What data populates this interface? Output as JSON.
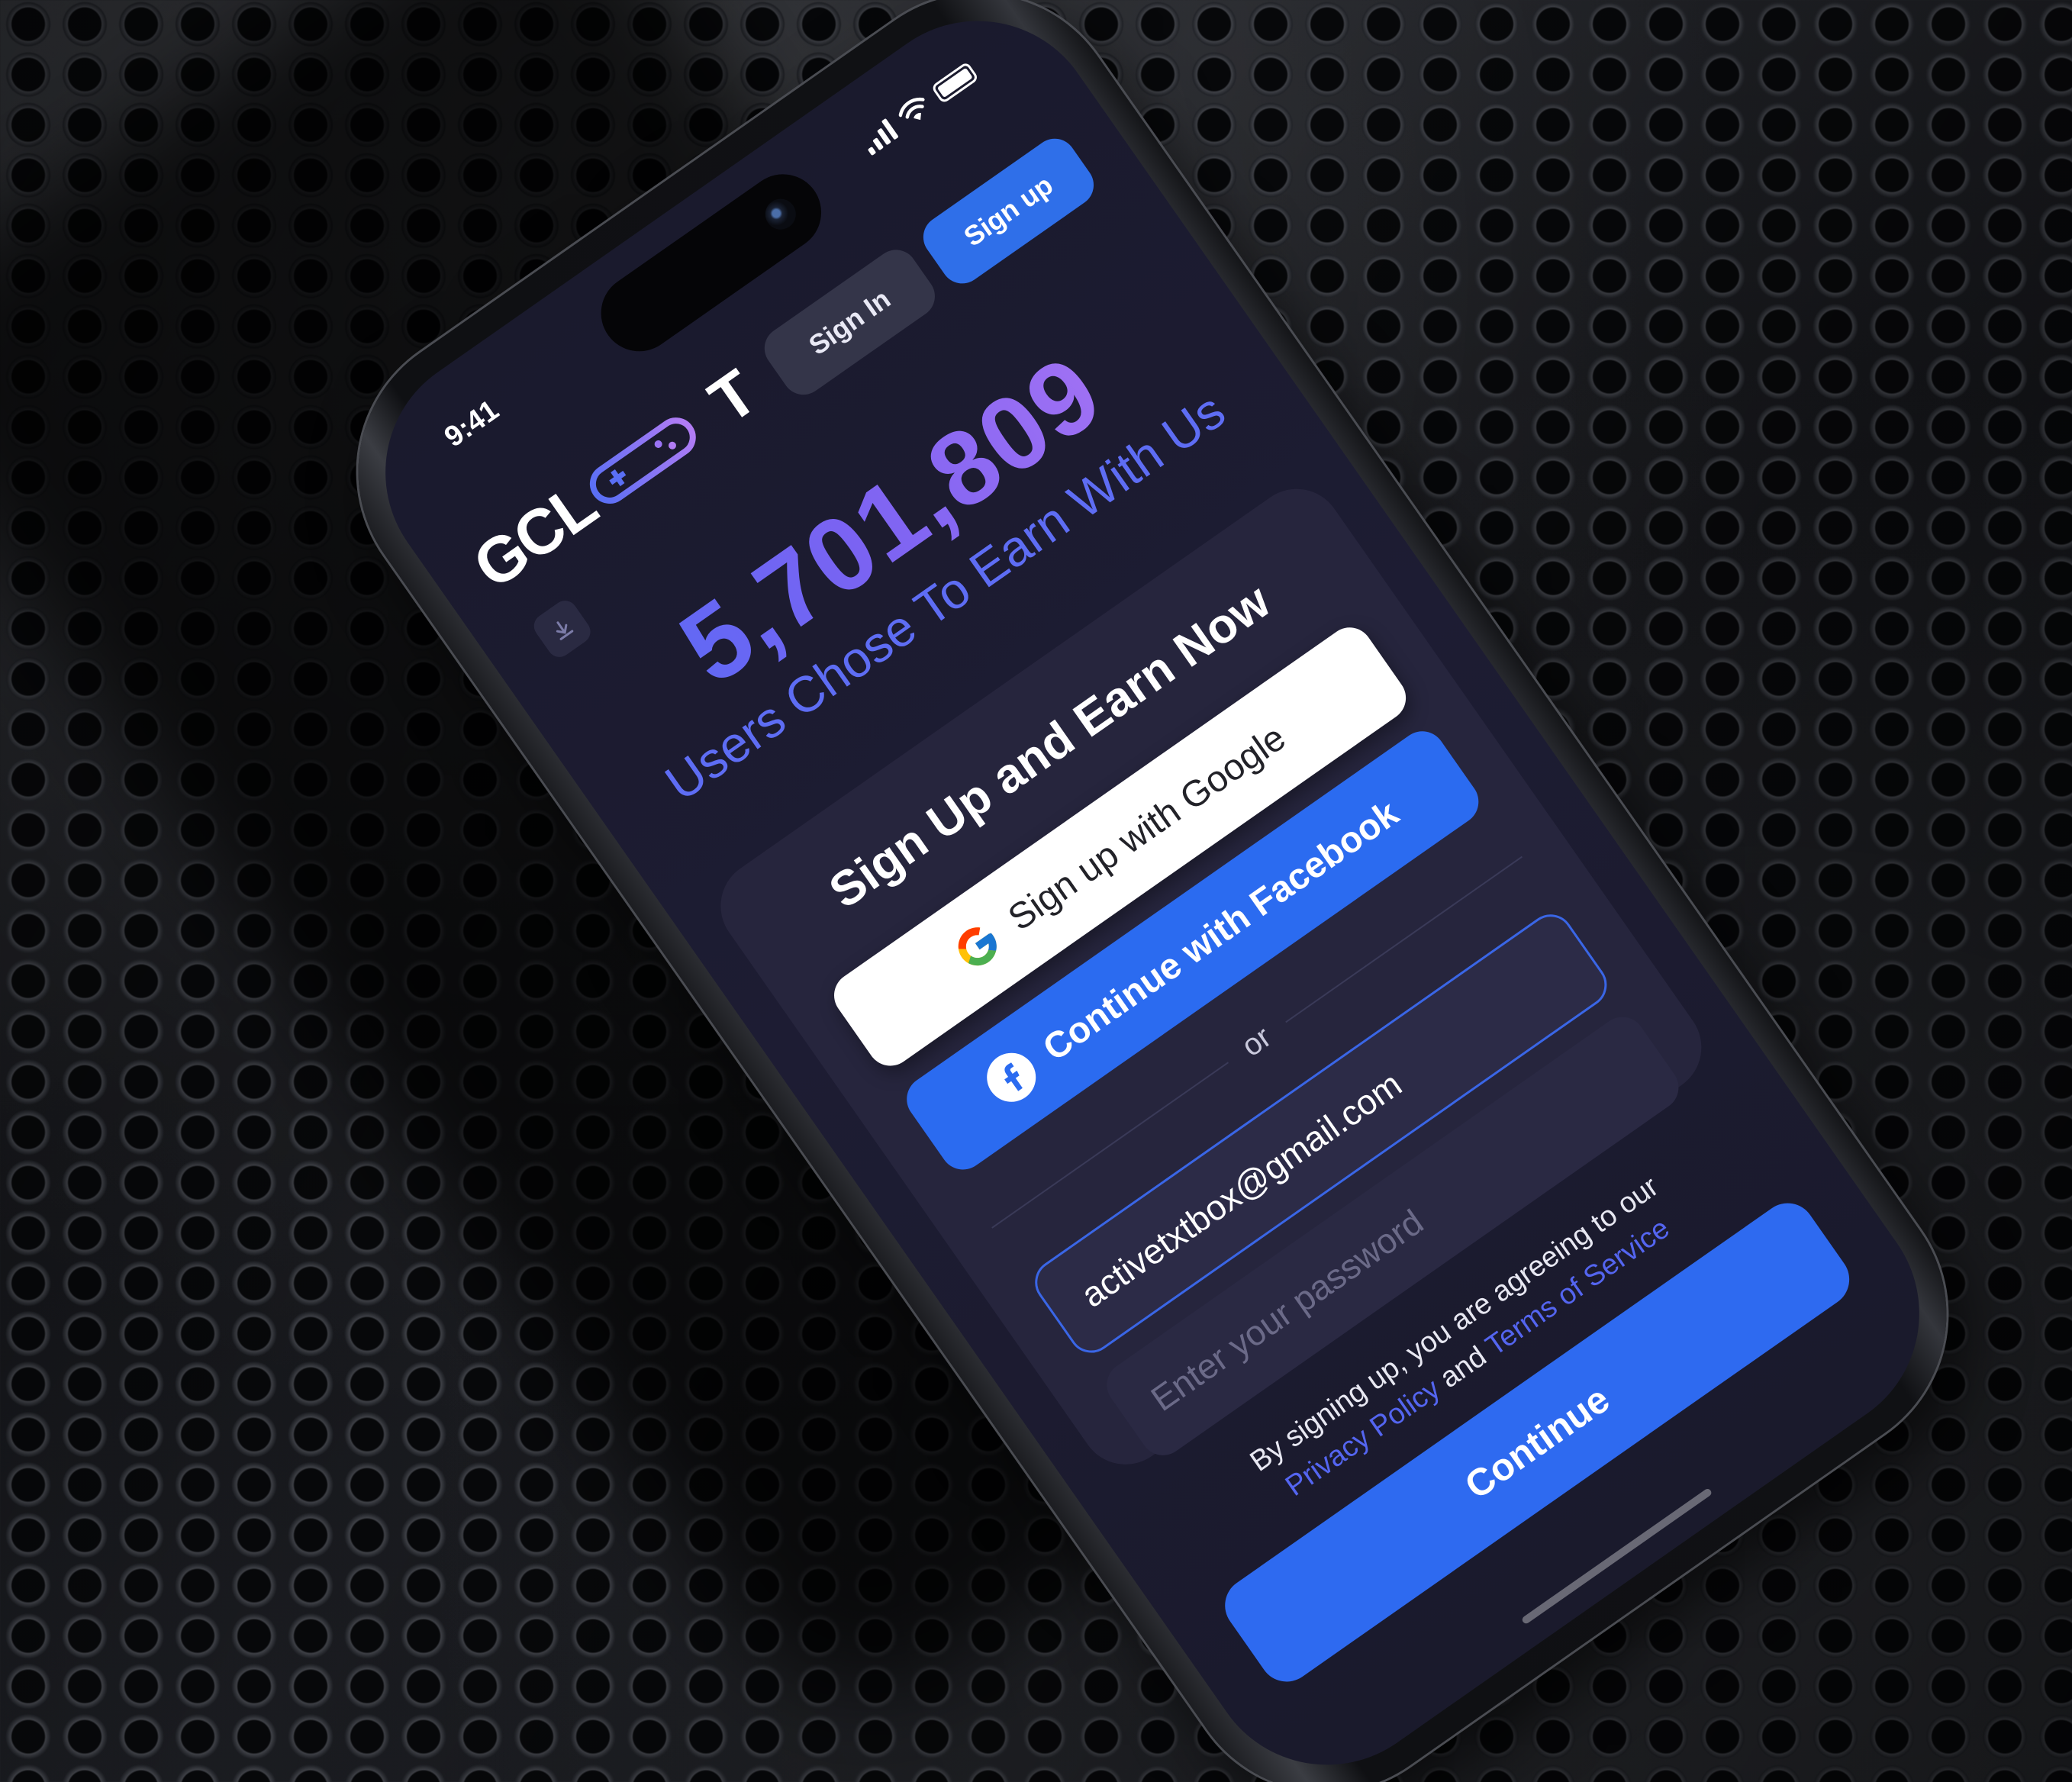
{
  "status_bar": {
    "time": "9:41",
    "icons": [
      "signal-icon",
      "wifi-icon",
      "battery-icon"
    ]
  },
  "header": {
    "logo_text": "GCL",
    "logo_tail": "T",
    "logo_icon": "gamepad-icon",
    "sign_in_label": "Sign In",
    "sign_up_label": "Sign up",
    "menu_icon": "download-icon"
  },
  "hero": {
    "count": "5,701,809",
    "subtitle": "Users Chose To Earn With Us"
  },
  "card": {
    "title": "Sign Up and Earn Now",
    "google_label": "Sign up with Google",
    "facebook_label": "Continue with Facebook",
    "divider_text": "or",
    "email_value": "activetxtbox@gmail.com",
    "password_placeholder": "Enter your password"
  },
  "legal": {
    "prefix": "By signing up, you are agreeing to our",
    "privacy": "Privacy Policy",
    "and": "and",
    "terms": "Terms of Service"
  },
  "continue_label": "Continue",
  "colors": {
    "accent": "#2f6fe9",
    "screen_bg": "#1a1a2d",
    "card_bg": "#26253d",
    "gradient_start": "#4d6cf6",
    "gradient_end": "#b478f4",
    "link": "#5465f0"
  }
}
